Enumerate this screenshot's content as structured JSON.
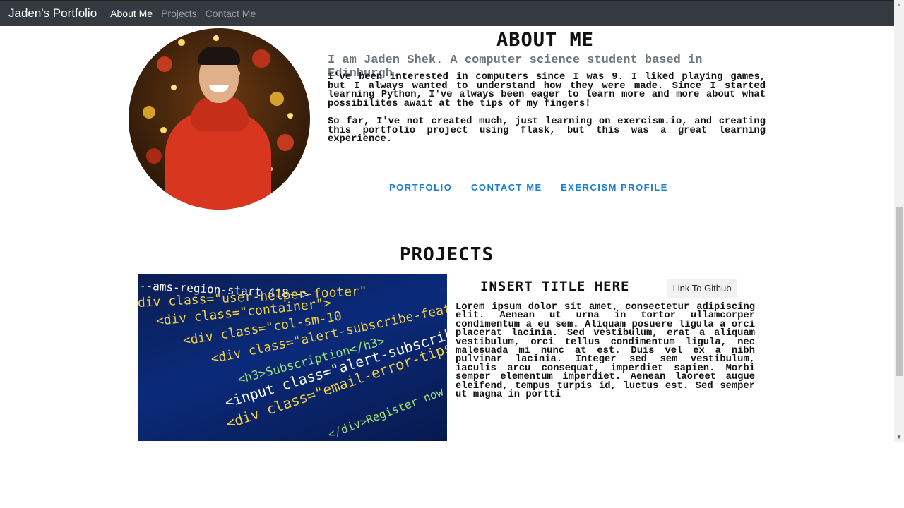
{
  "navbar": {
    "brand": "Jaden's Portfolio",
    "links": [
      {
        "label": "About Me",
        "active": true
      },
      {
        "label": "Projects",
        "active": false
      },
      {
        "label": "Contact Me",
        "active": false
      }
    ]
  },
  "about": {
    "title": "ABOUT ME",
    "lead": "I am Jaden Shek. A computer science student based in Edinburgh.",
    "paragraphs": [
      "I've been interested in computers since I was 9. I liked playing games, but I always wanted to understand how they were made. Since I started learning Python, I've always been eager to learn more and more about what possibilites await at the tips of my fingers!",
      "So far, I've not created much, just learning on exercism.io, and creating this portfolio project using flask, but this was a great learning experience."
    ],
    "links": [
      "PORTFOLIO",
      "CONTACT ME",
      "EXERCISM PROFILE"
    ]
  },
  "projects": {
    "title": "PROJECTS",
    "items": [
      {
        "title": "INSERT TITLE HERE",
        "button": "Link To Github",
        "description": "Lorem ipsum dolor sit amet, consectetur adipiscing elit. Aenean ut urna in tortor ullamcorper condimentum a eu sem. Aliquam posuere ligula a orci placerat lacinia. Sed vestibulum, erat a aliquam vestibulum, orci tellus condimentum ligula, nec malesuada mi nunc at est. Duis vel ex a nibh pulvinar lacinia. Integer sed sem vestibulum, iaculis arcu consequat, imperdiet sapien. Morbi semper elementum imperdiet. Aenean laoreet augue eleifend, tempus turpis id, luctus est. Sed semper ut magna in portti",
        "image_code_lines": [
          "--ams-region-start 418-->",
          "div class=\"user-helper-footer\"",
          "<div class=\"container\">",
          "<div class=\"col-sm-10",
          "<div class=\"alert-subscribe-feat",
          "<h3>Subscription</h3>",
          "<input class=\"alert-subscribe-input",
          "<div class=\"email-error-tips",
          "</div>Register now to rec"
        ]
      }
    ]
  },
  "colors": {
    "navbar_bg": "#343a40",
    "link_accent": "#1a7fd6",
    "lead_text": "#6c757d"
  }
}
